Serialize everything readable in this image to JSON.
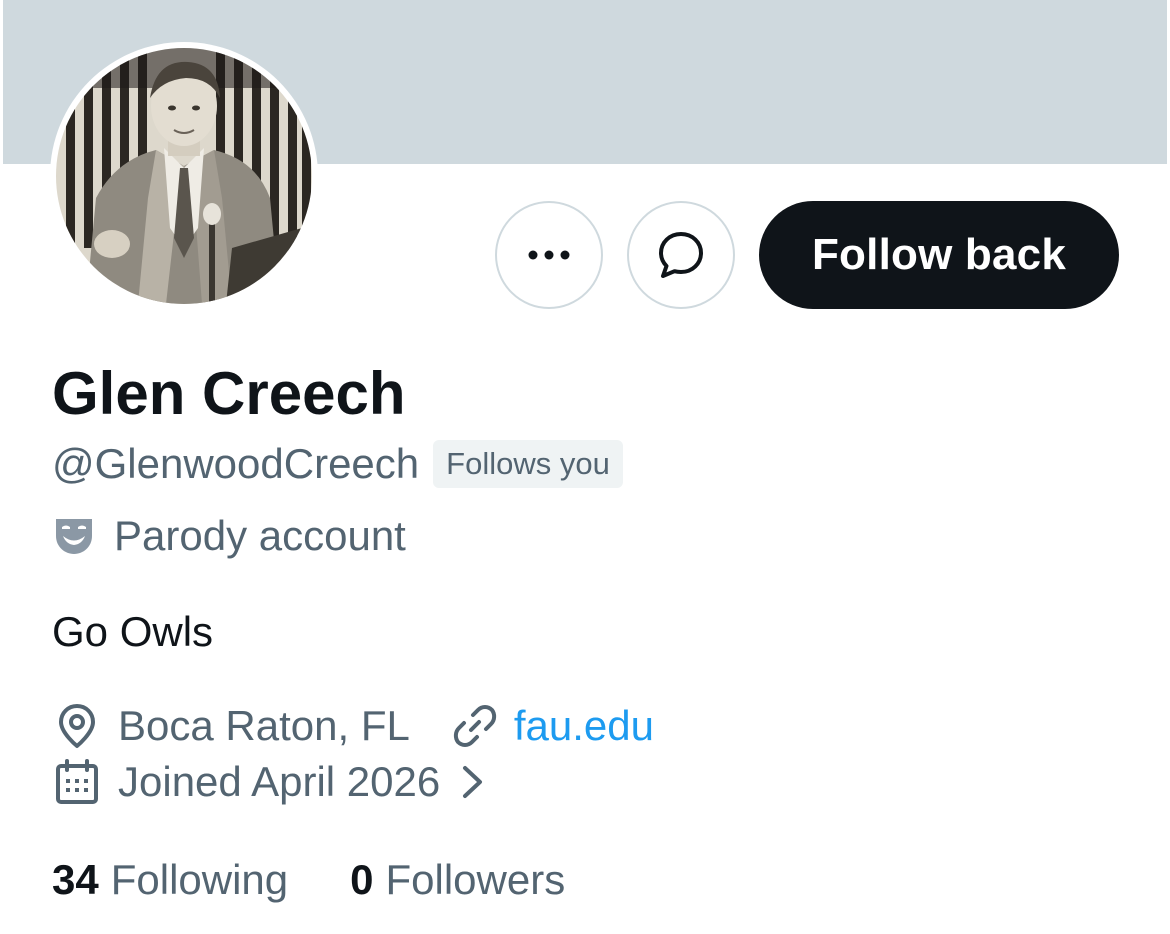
{
  "profile": {
    "display_name": "Glen Creech",
    "handle": "@GlenwoodCreech",
    "follows_you_badge": "Follows you",
    "account_label": "Parody account",
    "bio": "Go Owls",
    "location": "Boca Raton, FL",
    "website": "fau.edu",
    "joined": "Joined April 2026"
  },
  "actions": {
    "more_icon": "ellipsis-icon",
    "message_icon": "chat-bubble-icon",
    "follow_label": "Follow back"
  },
  "stats": {
    "following_count": "34",
    "following_label": "Following",
    "followers_count": "0",
    "followers_label": "Followers"
  },
  "icons": {
    "label": "theater-mask-icon",
    "location": "map-pin-icon",
    "website": "link-icon",
    "joined": "calendar-icon",
    "joined_more": "chevron-right-icon"
  },
  "colors": {
    "banner": "#cfd9de",
    "primary_text": "#0f1419",
    "secondary_text": "#536471",
    "link": "#1d9bf0",
    "follow_button_bg": "#0f1419",
    "badge_bg": "#eff3f4",
    "border": "#cfd9de"
  }
}
